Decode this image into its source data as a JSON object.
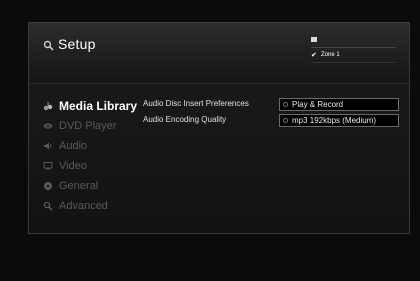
{
  "header": {
    "title": "Setup",
    "title_icon": "search-icon",
    "zone": {
      "label": "Zone 1",
      "checked": true
    }
  },
  "sidebar": {
    "items": [
      {
        "label": "Media Library",
        "icon": "music-notes-icon",
        "active": true
      },
      {
        "label": "DVD Player",
        "icon": "disc-icon",
        "active": false
      },
      {
        "label": "Audio",
        "icon": "speaker-icon",
        "active": false
      },
      {
        "label": "Video",
        "icon": "monitor-icon",
        "active": false
      },
      {
        "label": "General",
        "icon": "circle-icon",
        "active": false
      },
      {
        "label": "Advanced",
        "icon": "wrench-icon",
        "active": false
      }
    ]
  },
  "settings": {
    "rows": [
      {
        "label": "Audio Disc Insert Preferences",
        "value": "Play & Record"
      },
      {
        "label": "Audio Encoding Quality",
        "value": "mp3 192kbps (Medium)"
      }
    ]
  },
  "colors": {
    "background": "#0b0b0b",
    "panel": "#1c1c1c",
    "active_text": "#ffffff",
    "inactive_text": "#5a5a5a"
  }
}
